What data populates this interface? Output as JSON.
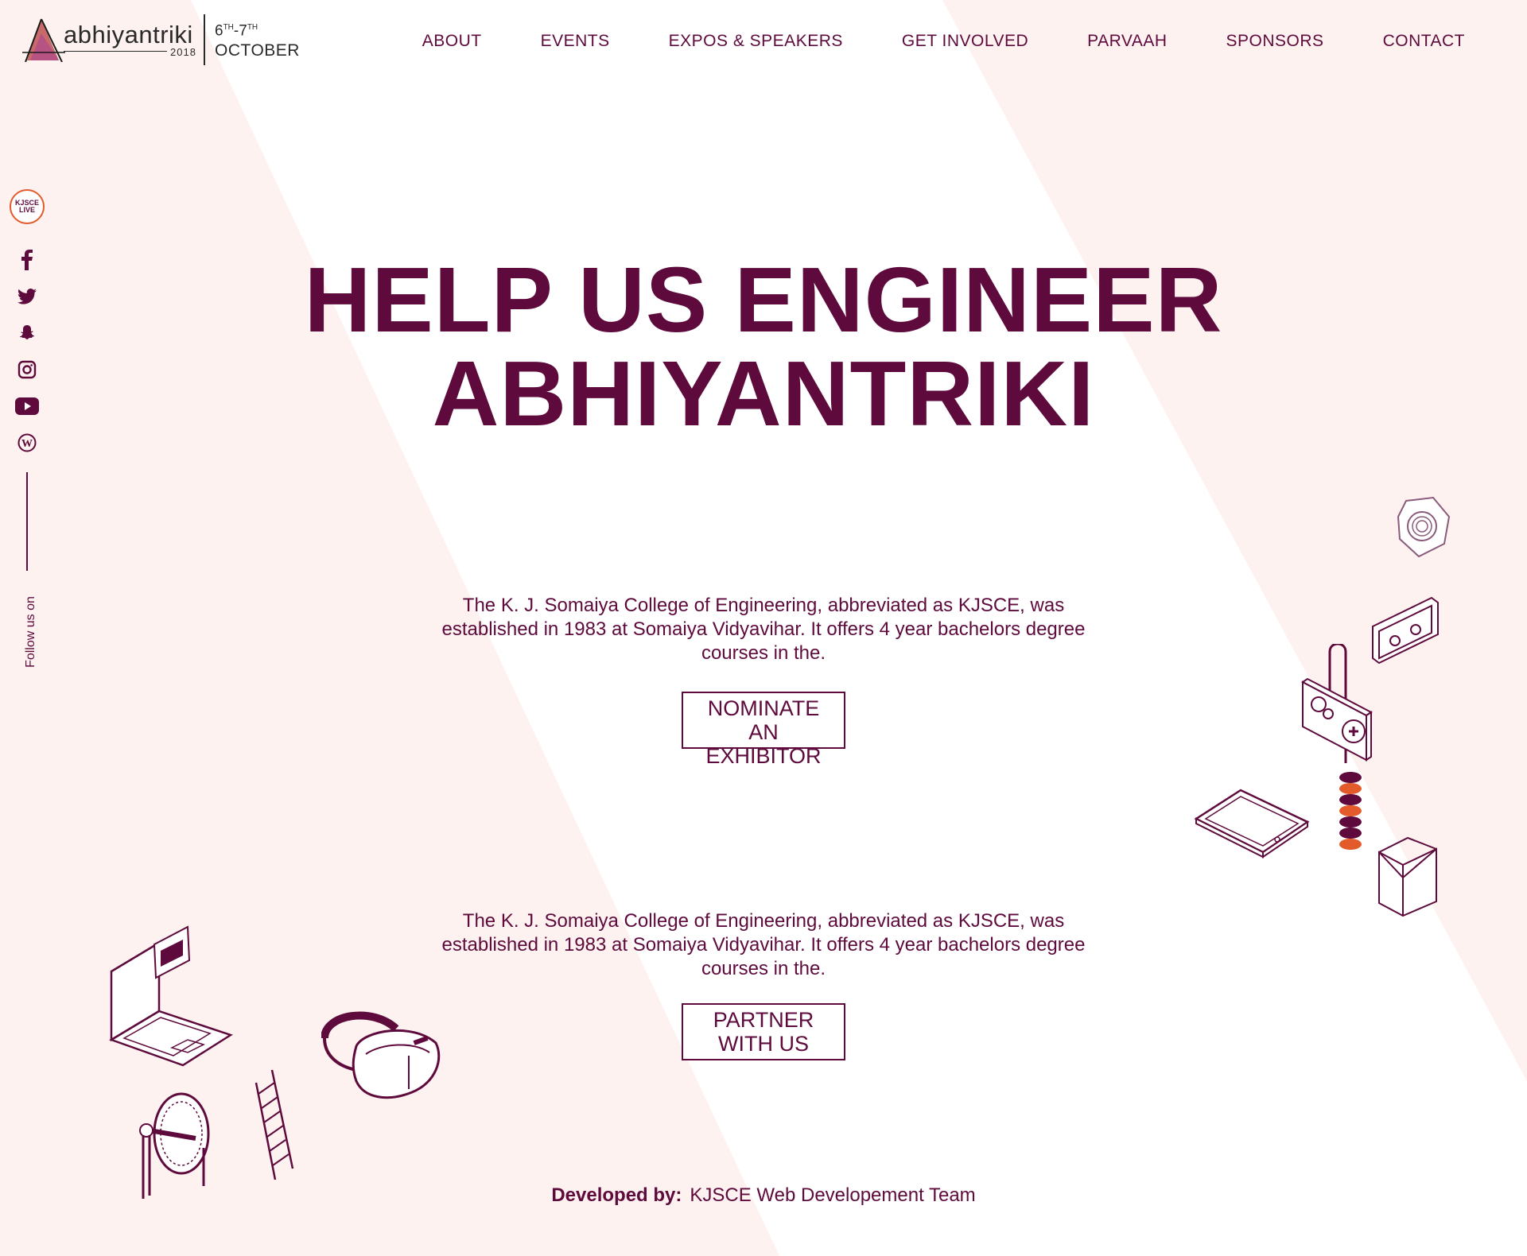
{
  "header": {
    "logo_text": "abhiyantriki",
    "logo_year": "2018",
    "date_start": "6",
    "date_start_sup": "TH",
    "date_sep": "-7",
    "date_end_sup": "TH",
    "month": "OCTOBER"
  },
  "nav": {
    "items": [
      "ABOUT",
      "EVENTS",
      "EXPOS & SPEAKERS",
      "GET INVOLVED",
      "PARVAAH",
      "SPONSORS",
      "CONTACT"
    ]
  },
  "social": {
    "kjsce_live_line1": "KJSCE",
    "kjsce_live_line2": "LIVE",
    "icons": [
      "facebook-icon",
      "twitter-icon",
      "snapchat-icon",
      "instagram-icon",
      "youtube-icon",
      "wordpress-icon"
    ],
    "follow_label": "Follow us on"
  },
  "hero": {
    "line1": "HELP US ENGINEER",
    "line2": "ABHIYANTRIKI"
  },
  "sections": [
    {
      "text": "The K. J. Somaiya College of Engineering, abbreviated as KJSCE, was established in 1983 at Somaiya Vidyavihar. It offers 4 year bachelors degree courses in the.",
      "button_line1": "NOMINATE",
      "button_line2": "AN EXHIBITOR"
    },
    {
      "text": "The K. J. Somaiya College of Engineering, abbreviated as KJSCE, was established in 1983 at Somaiya Vidyavihar. It offers 4 year bachelors degree courses in the.",
      "button_line1": "PARTNER",
      "button_line2": "WITH US"
    }
  ],
  "footer": {
    "label": "Developed by:",
    "team": "KJSCE Web Developement Team"
  },
  "colors": {
    "primary": "#5e0a3c",
    "background_shape": "#fdf2ef",
    "accent_orange": "#e35a2b"
  }
}
